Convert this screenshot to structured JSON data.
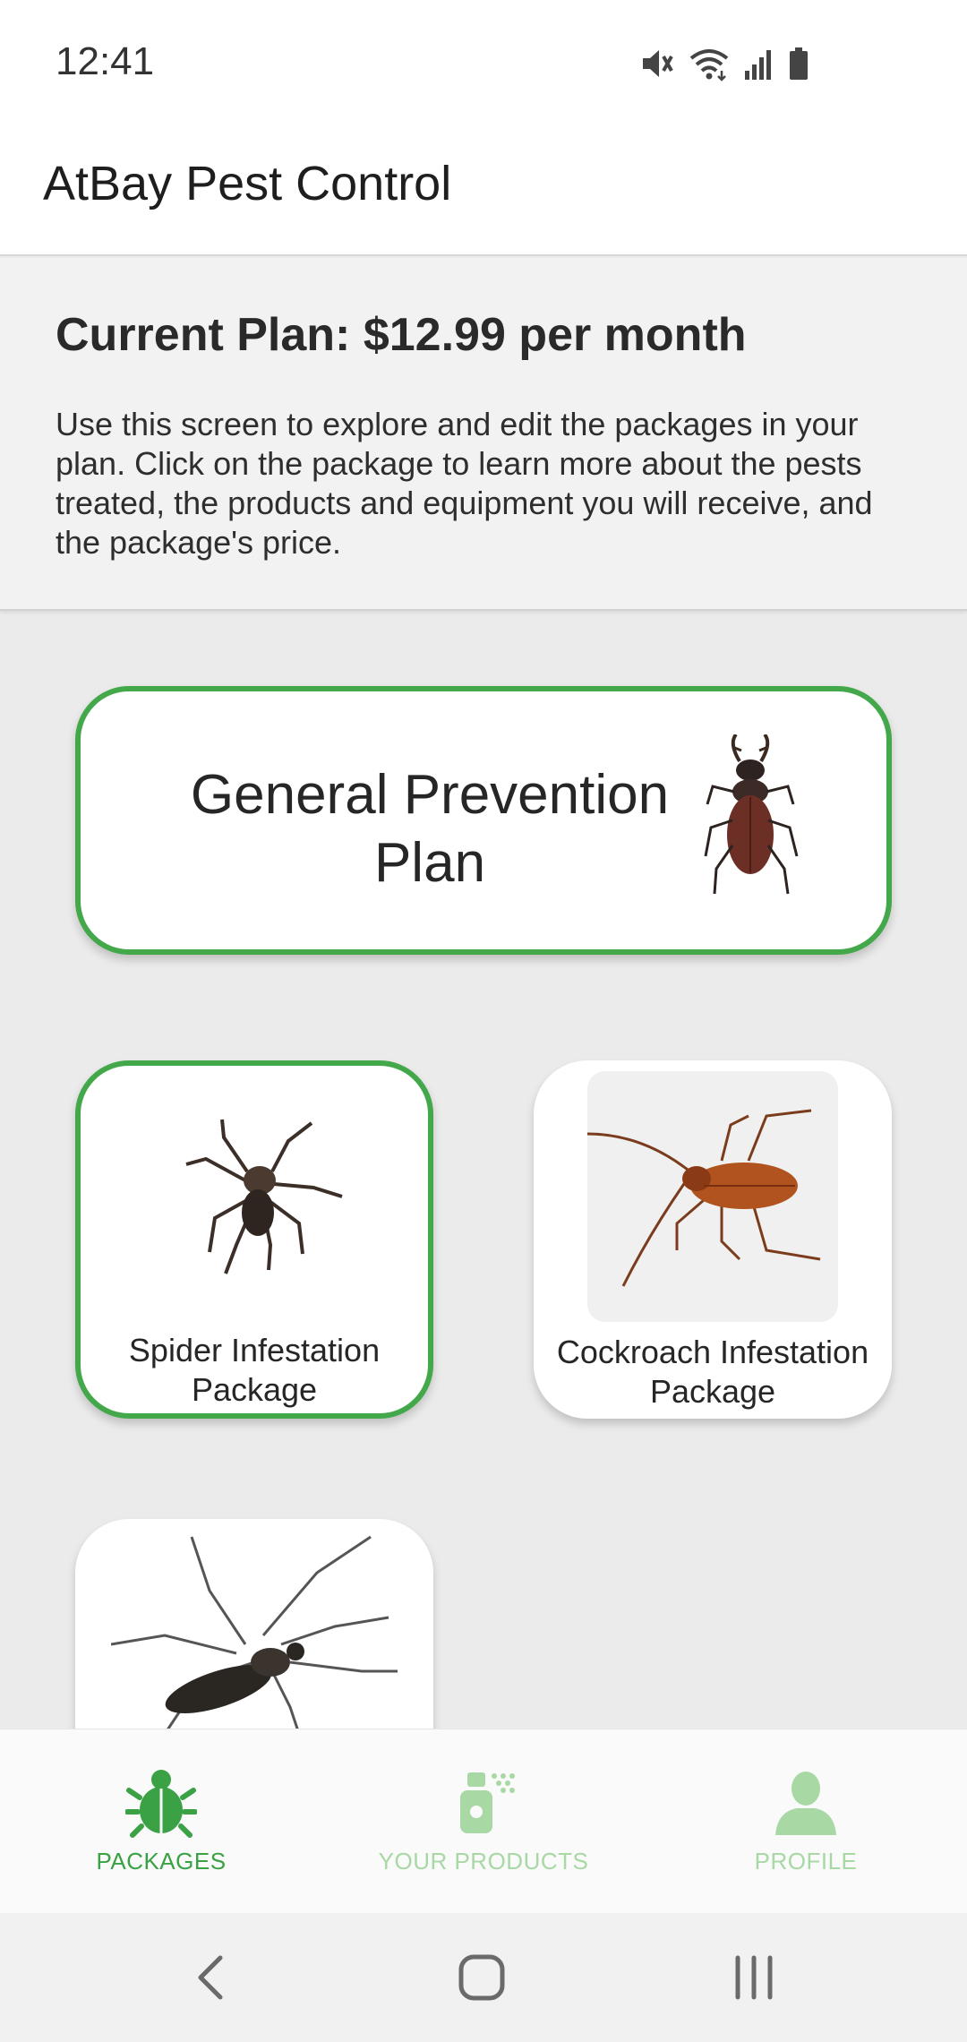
{
  "status_bar": {
    "time": "12:41",
    "icons": [
      "mute-icon",
      "wifi-icon",
      "signal-icon",
      "battery-icon"
    ]
  },
  "app": {
    "title": "AtBay Pest Control"
  },
  "plan": {
    "title": "Current Plan: $12.99 per month",
    "description": "Use this screen to explore and edit the packages in your plan. Click on the package to learn more about the pests treated, the products and equipment you will receive, and the package's price."
  },
  "packages": {
    "general": {
      "label_line1": "General Prevention",
      "label_line2": "Plan",
      "selected": true
    },
    "spider": {
      "label_line1": "Spider Infestation",
      "label_line2": "Package",
      "selected": true
    },
    "cockroach": {
      "label_line1": "Cockroach Infestation",
      "label_line2": "Package",
      "selected": false
    },
    "mosquito": {
      "selected": false
    }
  },
  "bottom_nav": {
    "items": [
      {
        "label": "PACKAGES",
        "icon": "bug-icon",
        "active": true
      },
      {
        "label": "YOUR PRODUCTS",
        "icon": "spray-bottle-icon",
        "active": false
      },
      {
        "label": "PROFILE",
        "icon": "person-icon",
        "active": false
      }
    ]
  },
  "colors": {
    "accent_green": "#43a84a",
    "inactive_green": "#a8d8a4",
    "background": "#ebebeb"
  }
}
